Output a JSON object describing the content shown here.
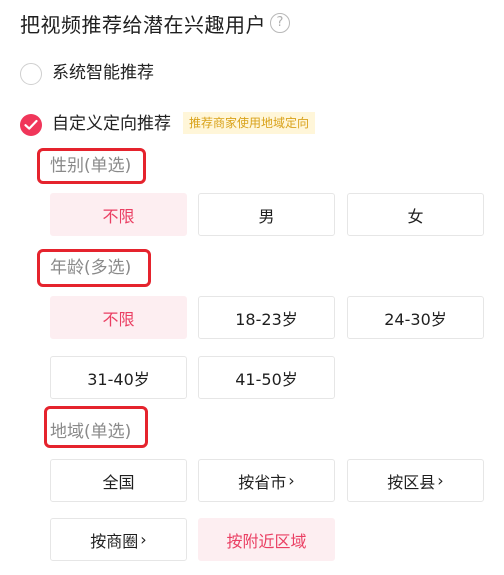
{
  "title": "把视频推荐给潜在兴趣用户",
  "help_icon": "?",
  "options": [
    {
      "label": "系统智能推荐",
      "checked": false
    },
    {
      "label": "自定义定向推荐",
      "checked": true,
      "tag": "推荐商家使用地域定向"
    }
  ],
  "gender": {
    "label": "性别(单选)",
    "chips": [
      {
        "label": "不限",
        "selected": true
      },
      {
        "label": "男",
        "selected": false
      },
      {
        "label": "女",
        "selected": false
      }
    ]
  },
  "age": {
    "label": "年龄(多选)",
    "chips": [
      {
        "label": "不限",
        "selected": true
      },
      {
        "label": "18-23岁",
        "selected": false
      },
      {
        "label": "24-30岁",
        "selected": false
      },
      {
        "label": "31-40岁",
        "selected": false
      },
      {
        "label": "41-50岁",
        "selected": false
      }
    ]
  },
  "region": {
    "label": "地域(单选)",
    "chips": [
      {
        "label": "全国",
        "selected": false
      },
      {
        "label": "按省市",
        "selected": false,
        "chevron": "›"
      },
      {
        "label": "按区县",
        "selected": false,
        "chevron": "›"
      },
      {
        "label": "按商圈",
        "selected": false,
        "chevron": "›"
      },
      {
        "label": "按附近区域",
        "selected": true
      }
    ]
  },
  "colors": {
    "accent": "#f0365a",
    "highlight_box": "#e5232d",
    "tag_bg": "#fff6d9",
    "tag_text": "#d9a21a"
  }
}
